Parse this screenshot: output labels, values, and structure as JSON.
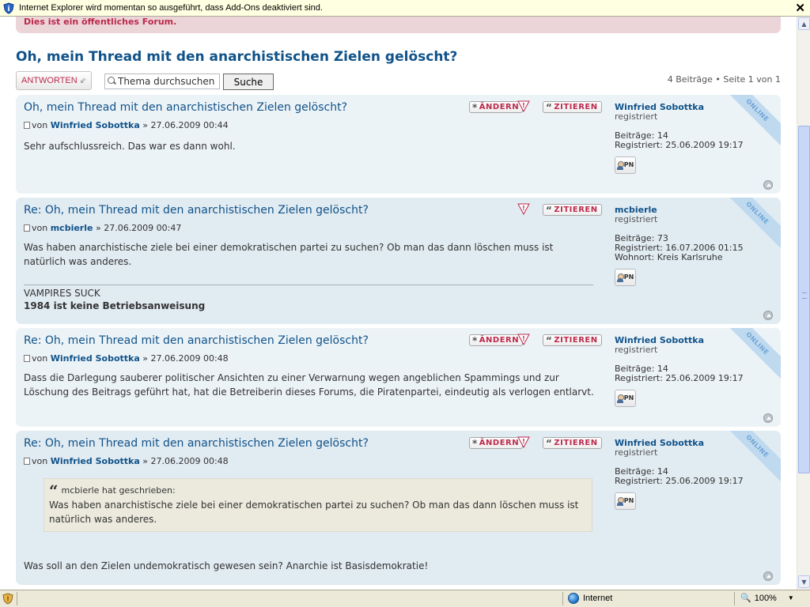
{
  "infobar": {
    "message": "Internet Explorer wird momentan so ausgeführt, dass Add-Ons deaktiviert sind.",
    "close_label": "✕"
  },
  "notice": "Dies ist ein öffentliches Forum.",
  "topic_title": "Oh, mein Thread mit den anarchistischen Zielen gelöscht?",
  "toolbar": {
    "reply_label": "ANTWORTEN",
    "search_placeholder": "Thema durchsuchen",
    "search_value": "Thema durchsuchen",
    "search_button": "Suche",
    "pagination": "4 Beiträge • Seite 1 von 1"
  },
  "labels": {
    "edit": "ÄNDERN",
    "quote": "ZITIEREN",
    "by": "von",
    "posts": "Beiträge:",
    "registered": "Registriert:",
    "location": "Wohnort:",
    "online": "ONLINE",
    "pm": "PN"
  },
  "posts": [
    {
      "title": "Oh, mein Thread mit den anarchistischen Zielen gelöscht?",
      "author": "Winfried Sobottka",
      "datetime": "» 27.06.2009 00:44",
      "body": "Sehr aufschlussreich. Das war es dann wohl.",
      "username": "Winfried Sobottka",
      "rank": "registriert",
      "post_count": "14",
      "joined": "25.06.2009 19:17"
    },
    {
      "title": "Re: Oh, mein Thread mit den anarchistischen Zielen gelöscht?",
      "author": "mcbierle",
      "datetime": "» 27.06.2009 00:47",
      "body": "Was haben anarchistische ziele bei einer demokratischen partei zu suchen? Ob man das dann löschen muss ist natürlich was anderes.",
      "signature_line1": "VAMPIRES SUCK",
      "signature_line2": "1984 ist keine Betriebsanweisung",
      "username": "mcbierle",
      "rank": "registriert",
      "post_count": "73",
      "joined": "16.07.2006 01:15",
      "location": "Kreis Karlsruhe"
    },
    {
      "title": "Re: Oh, mein Thread mit den anarchistischen Zielen gelöscht?",
      "author": "Winfried Sobottka",
      "datetime": "» 27.06.2009 00:48",
      "body": "Dass die Darlegung sauberer politischer Ansichten zu einer Verwarnung wegen angeblichen Spammings und zur Löschung des Beitrags geführt hat, hat die Betreiberin dieses Forums, die Piratenpartei, eindeutig als verlogen entlarvt.",
      "username": "Winfried Sobottka",
      "rank": "registriert",
      "post_count": "14",
      "joined": "25.06.2009 19:17"
    },
    {
      "title": "Re: Oh, mein Thread mit den anarchistischen Zielen gelöscht?",
      "author": "Winfried Sobottka",
      "datetime": "» 27.06.2009 00:48",
      "quote_head": "mcbierle hat geschrieben:",
      "quote_body": "Was haben anarchistische ziele bei einer demokratischen partei zu suchen? Ob man das dann löschen muss ist natürlich was anderes.",
      "body": "Was soll an den Zielen undemokratisch gewesen sein? Anarchie ist Basisdemokratie!",
      "username": "Winfried Sobottka",
      "rank": "registriert",
      "post_count": "14",
      "joined": "25.06.2009 19:17"
    }
  ],
  "statusbar": {
    "zone": "Internet",
    "zoom": "100%"
  },
  "colors": {
    "link": "#105289",
    "accent": "#bc2a4d",
    "post_bg1": "#e1ebf2",
    "post_bg2": "#ecf3f7"
  }
}
